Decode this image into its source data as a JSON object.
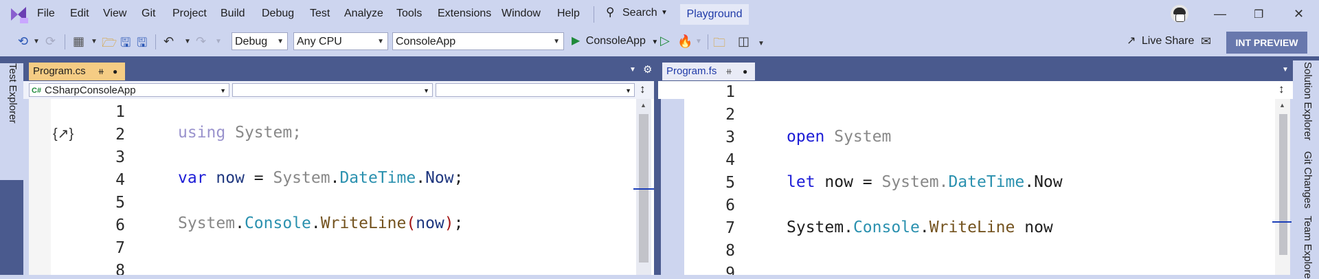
{
  "menu": [
    "File",
    "Edit",
    "View",
    "Git",
    "Project",
    "Build",
    "Debug",
    "Test",
    "Analyze",
    "Tools",
    "Extensions",
    "Window",
    "Help"
  ],
  "search_label": "Search",
  "solution_name": "Playground",
  "toolbar": {
    "config": "Debug",
    "platform": "Any CPU",
    "startup_project": "ConsoleApp",
    "run_label": "ConsoleApp",
    "live_share": "Live Share",
    "int_preview": "INT PREVIEW"
  },
  "left_rail": {
    "test_explorer": "Test Explorer"
  },
  "right_rail": {
    "solution_explorer": "Solution Explorer",
    "git_changes": "Git Changes",
    "team_explorer": "Team Explore"
  },
  "left_pane": {
    "tab": "Program.cs",
    "nav_project": "CSharpConsoleApp",
    "line_numbers": [
      "1",
      "2",
      "3",
      "4",
      "5",
      "6",
      "7",
      "8"
    ],
    "code": {
      "l2": [
        "using",
        " System;"
      ],
      "l4": [
        "var",
        " now",
        " = ",
        "System",
        ".",
        "DateTime",
        ".",
        "Now",
        ";"
      ],
      "l6": [
        "System",
        ".",
        "Console",
        ".",
        "WriteLine",
        "(",
        "now",
        ")",
        ";"
      ]
    }
  },
  "right_pane": {
    "tab": "Program.fs",
    "line_numbers": [
      "1",
      "2",
      "3",
      "4",
      "5",
      "6",
      "7",
      "8",
      "9"
    ],
    "code": {
      "l3": [
        "open",
        " System"
      ],
      "l5": [
        "let",
        " now = ",
        "System",
        ".",
        "DateTime",
        ".",
        "Now"
      ],
      "l7": [
        "System",
        ".",
        "Console",
        ".",
        "WriteLine",
        " now"
      ]
    }
  },
  "colors": {
    "chrome": "#cdd5ef",
    "tab_active": "#f5cc84",
    "accent": "#1f3aa8",
    "keyword": "#1c1cd6",
    "type": "#2b91af",
    "method": "#74531f"
  }
}
